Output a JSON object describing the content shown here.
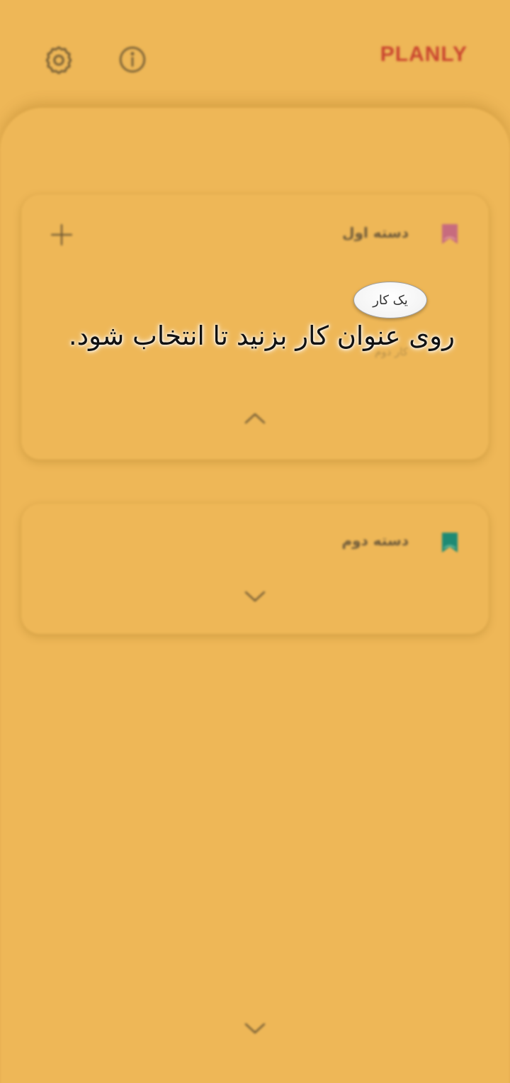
{
  "app": {
    "logo": "PLANLY"
  },
  "header": {
    "settings_icon": "gear-icon",
    "info_icon": "info-icon"
  },
  "categories": [
    {
      "title": "دسته اول",
      "bookmark_color": "#C76B7E",
      "tasks": [
        "کار دوم"
      ],
      "expanded": true
    },
    {
      "title": "دسته دوم",
      "bookmark_color": "#1E8A74",
      "tasks": [],
      "expanded": false
    }
  ],
  "tutorial": {
    "bubble_label": "یک کار",
    "instruction": "روی عنوان کار بزنید تا انتخاب شود."
  },
  "colors": {
    "background": "#EEB757",
    "logo": "#C9452F"
  }
}
